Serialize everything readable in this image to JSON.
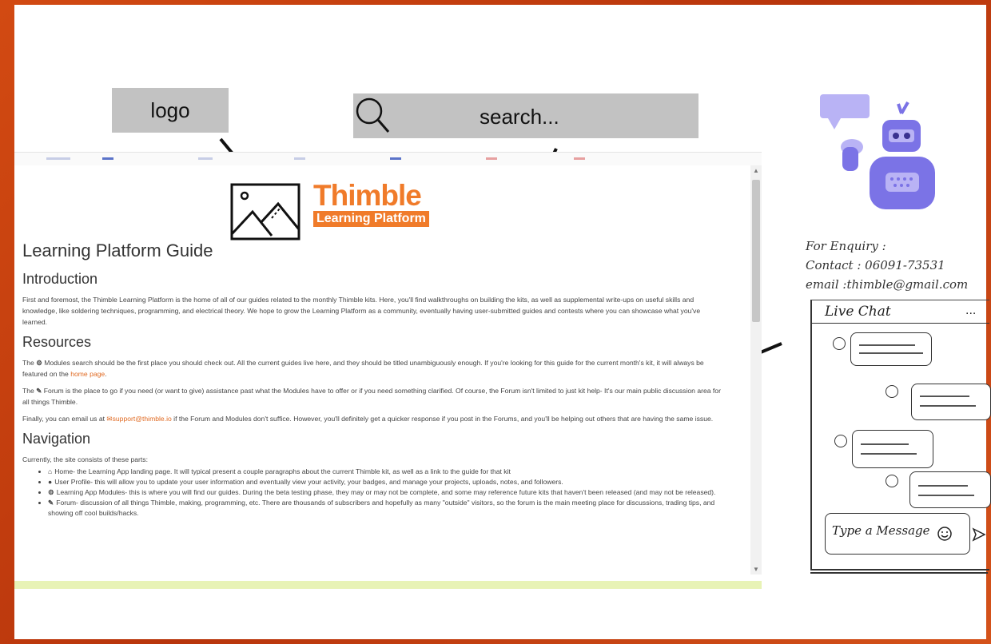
{
  "annotations": {
    "logo_label": "logo",
    "search_placeholder": "search..."
  },
  "site": {
    "brand_name": "Thimble",
    "brand_sub": "Learning Platform",
    "page_title": "Learning Platform Guide",
    "intro_heading": "Introduction",
    "intro_text": "First and foremost, the Thimble Learning Platform is the home of all of our guides related to the monthly Thimble kits. Here, you'll find walkthroughs on building the kits, as well as supplemental write-ups on useful skills and knowledge, like soldering techniques, programming, and electrical theory. We hope to grow the Learning Platform as a community, eventually having user-submitted guides and contests where you can showcase what you've learned.",
    "resources_heading": "Resources",
    "res_p1_a": "The ",
    "res_p1_b": " Modules search should be the first place you should check out. All the current guides live here, and they should be titled unambiguously enough. If you're looking for this guide for the current month's kit, it will always be featured on the ",
    "res_p1_link": "home page",
    "res_p1_c": ".",
    "res_p2_a": "The ",
    "res_p2_b": " Forum is the place to go if you need (or want to give) assistance past what the Modules have to offer or if you need something clarified. Of course, the Forum isn't limited to just kit help- It's our main public discussion area for all things Thimble.",
    "res_p3_a": "Finally, you can email us at ",
    "res_p3_link": "support@thimble.io",
    "res_p3_b": " if the Forum and Modules don't suffice. However, you'll definitely get a quicker response if you post in the Forums, and you'll be helping out others that are having the same issue.",
    "nav_heading": "Navigation",
    "nav_intro": "Currently, the site consists of these parts:",
    "nav_items": [
      {
        "icon": "home-icon",
        "glyph": "⌂",
        "text": "Home- the Learning App landing page. It will typical present a couple paragraphs about the current Thimble kit, as well as a link to the guide for that kit"
      },
      {
        "icon": "user-icon",
        "glyph": "●",
        "text": "User Profile- this will allow you to update your user information and eventually view your activity, your badges, and manage your projects, uploads, notes, and followers."
      },
      {
        "icon": "modules-icon",
        "glyph": "⚙",
        "text": "Learning App Modules- this is where you will find our guides. During the beta testing phase, they may or may not be complete, and some may reference future kits that haven't been released (and may not be released)."
      },
      {
        "icon": "forum-icon",
        "glyph": "✎",
        "text": "Forum- discussion of all things Thimble, making, programming, etc. There are thousands of subscribers and hopefully as many \"outside\" visitors, so the forum is the main meeting place for discussions, trading tips, and showing off cool builds/hacks."
      }
    ]
  },
  "contact": {
    "enquiry": "For Enquiry :",
    "contact": "Contact : 06091-73531",
    "email": "email :thimble@gmail.com"
  },
  "chat": {
    "title": "Live Chat",
    "more": "...",
    "placeholder": "Type a Message"
  },
  "colors": {
    "brand_orange": "#f07b2a",
    "border_orange": "#c8400f",
    "robot_purple": "#7b73e6",
    "robot_light": "#b9b3f5"
  }
}
